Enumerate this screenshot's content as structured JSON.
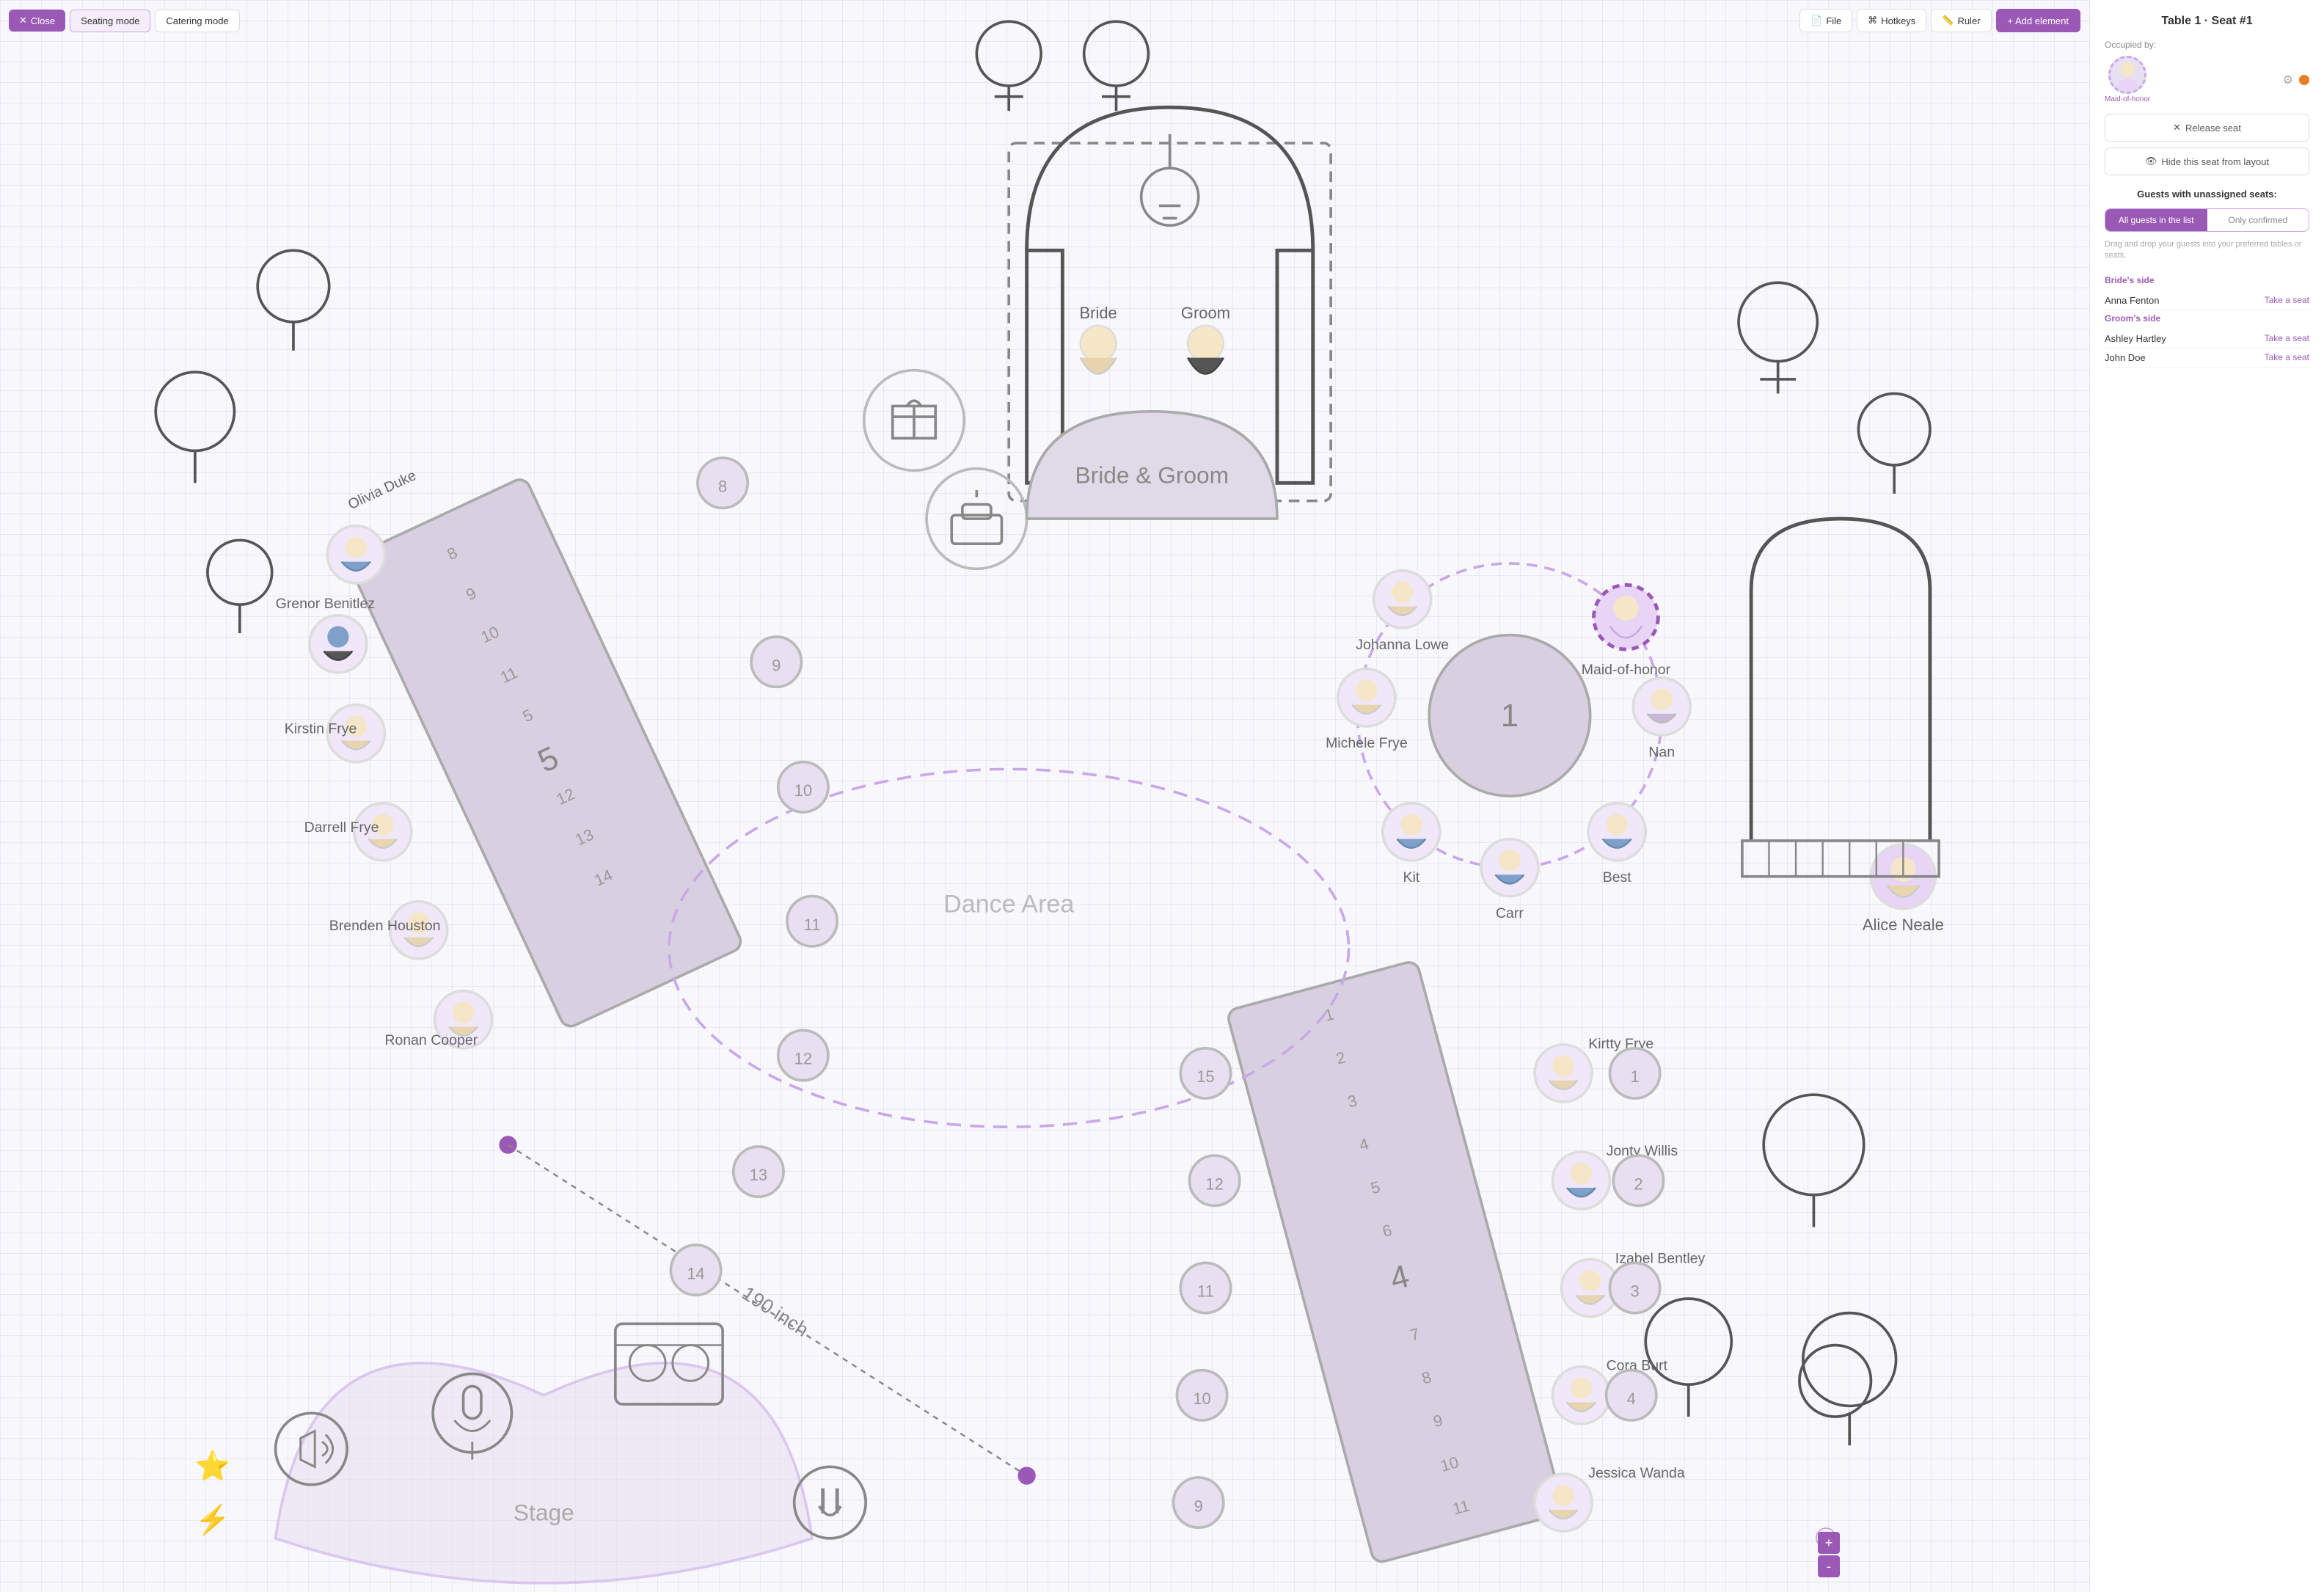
{
  "toolbar": {
    "close_label": "Close",
    "seating_mode_label": "Seating mode",
    "catering_mode_label": "Catering mode",
    "file_label": "File",
    "hotkeys_label": "Hotkeys",
    "ruler_label": "Ruler",
    "add_element_label": "+ Add element"
  },
  "right_panel": {
    "title": "Table 1 · Seat #1",
    "occupied_by_label": "Occupied by:",
    "guest_role": "Maid-of-honor",
    "release_seat_label": "Release seat",
    "hide_seat_label": "Hide this seat from layout",
    "guests_section_title": "Guests with unassigned seats:",
    "filter_all_label": "All guests in the list",
    "filter_confirmed_label": "Only confirmed",
    "drag_hint": "Drag and drop your guests into your preferred tables or seats.",
    "bride_side_label": "Bride's side",
    "groom_side_label": "Groom's side",
    "take_seat": "Take a seat",
    "guests": [
      {
        "side": "bride",
        "name": "Anna Fenton"
      },
      {
        "side": "groom",
        "name": "Ashley Hartley"
      },
      {
        "side": "groom",
        "name": "John Doe"
      }
    ]
  },
  "canvas": {
    "dance_area_label": "Dance Area",
    "stage_label": "Stage",
    "bride_groom_label": "Bride & Groom",
    "bride_label": "Bride",
    "groom_label": "Groom",
    "table1_label": "1",
    "table4_label": "4",
    "table5_label": "5",
    "measurement_label": "190 inch",
    "zoom_in": "+",
    "zoom_out": "-"
  }
}
